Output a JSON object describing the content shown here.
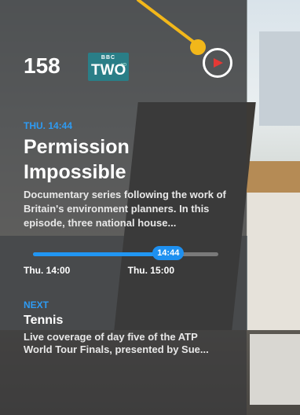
{
  "channel": {
    "number": "158",
    "logo_top": "BBC",
    "logo_main": "TWO",
    "logo_badge": "HD"
  },
  "now": {
    "time_label": "THU. 14:44",
    "title": "Permission Impossible",
    "description": "Documentary series following the work of Britain's environment planners. In this episode, three national house...",
    "current_time": "14:44",
    "start": "Thu. 14:00",
    "end": "Thu. 15:00",
    "progress": 0.73
  },
  "next": {
    "label": "NEXT",
    "title": "Tennis",
    "description": "Live coverage of day five of the ATP World Tour Finals, presented by Sue..."
  },
  "icons": {
    "play": "play-icon",
    "pointer": "pointer-annotation"
  },
  "colors": {
    "accent": "#2196f3",
    "play": "#e53935",
    "pointer": "#f2b71a"
  }
}
